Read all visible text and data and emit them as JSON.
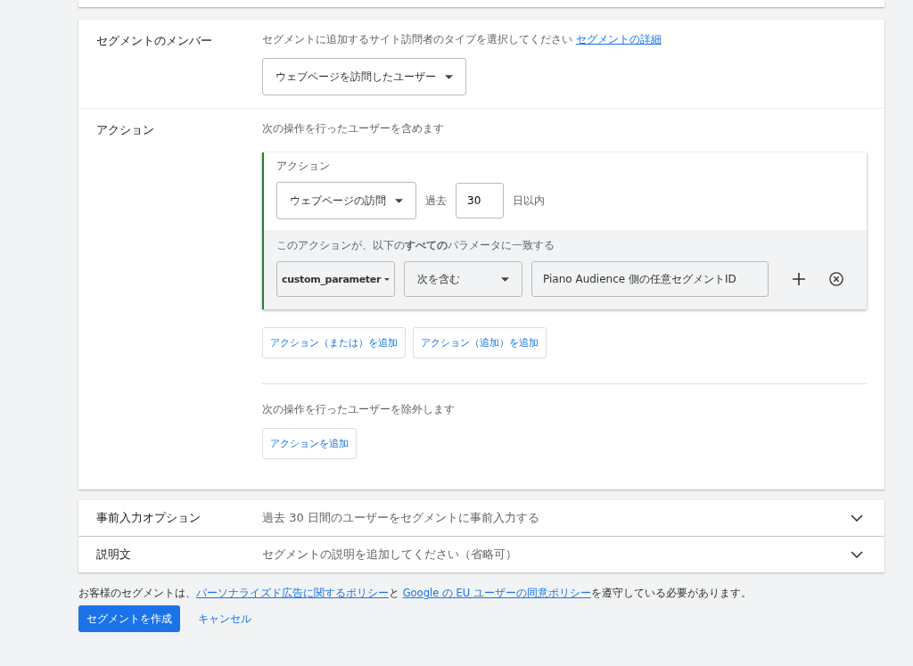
{
  "members": {
    "label": "セグメントのメンバー",
    "hint": "セグメントに追加するサイト訪問者のタイプを選択してください",
    "hint_link": "セグメントの詳細",
    "dropdown": "ウェブページを訪問したユーザー"
  },
  "actions": {
    "label": "アクション",
    "include_hint": "次の操作を行ったユーザーを含めます",
    "action_block": {
      "title": "アクション",
      "event_dropdown": "ウェブページの訪問",
      "past_label": "過去",
      "days_value": "30",
      "days_unit": "日以内",
      "condition_title": "このアクションが、以下の**すべての**パラメータに一致する",
      "conditions": [
        {
          "parameter": "custom_parameter",
          "operator": "次を含む",
          "value": "Piano Audience 側の任意セグメントID"
        }
      ]
    },
    "include_buttons": [
      "アクション（または）を追加",
      "アクション（追加）を追加"
    ],
    "exclude_hint": "次の操作を行ったユーザーを除外します",
    "exclude_button": "アクションを追加"
  },
  "collapsed_sections": [
    {
      "label": "事前入力オプション",
      "summary": "過去 30 日間のユーザーをセグメントに事前入力する",
      "expanded": false
    },
    {
      "label": "説明文",
      "summary": "セグメントの説明を追加してください（省略可）",
      "expanded": false
    }
  ],
  "policy_notice": {
    "before": "お客様のセグメントは、",
    "link_1": "パーソナライズド広告に関するポリシー",
    "middle": "と ",
    "link_2": "Google の EU ユーザーの同意ポリシー",
    "after": "を遵守している必要があります。"
  },
  "buttons": {
    "create": "セグメントを作成",
    "cancel": "キャンセル"
  }
}
